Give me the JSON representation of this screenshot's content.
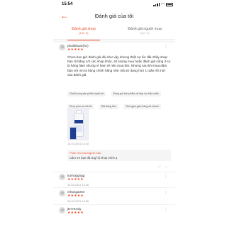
{
  "status_bar": {
    "time": "15:54"
  },
  "header": {
    "back_icon": "arrow-left-icon",
    "title": "Đánh giá của tôi"
  },
  "tabs": [
    {
      "label": "Đánh giá shop",
      "count": "(0,0 / 5)",
      "active": true
    },
    {
      "label": "Đánh giá người mua",
      "count": "(0,0 / 5)",
      "active": false
    }
  ],
  "reviews": [
    {
      "username": "phuletham(ho)",
      "stars": "★★★★★",
      "text": "Chưa bao giờ đánh giá dài như vậy nhưng thiệt sự lúc đầu thấy shop bán rẻ bằng 1/2 các shop khác, số lượng mua hoặc đánh giá cũng ít so là hàng fake nhưng vì ham rẻ nên mua thử. Nhưng sau khi mua đảm bảo với mn là hàng chính hãng nhé. Đã sử dụng hơn 1 tuần rồi mới vào đánh giá",
      "tags": [
        "Chất lượng sản phẩm tuyệt vời",
        "Đóng gói sản phẩm rất đẹp và chắc chắn",
        "Shop phục vụ rất tốt",
        "Rất đáng tiền",
        "Thời gian giao hàng rất nhanh"
      ],
      "date": "10-03-2021 14:18",
      "reply_header": "Phản Hồi của Người bán:",
      "reply_text": "Cảm ơn bạn đã ủng hộ shop mình ạ"
    },
    {
      "username": "tunhopgngg",
      "stars": "★★★★★",
      "date": "10-03-2021 10:26"
    },
    {
      "username": "mhang2204",
      "stars": "★★★★★",
      "date": "08-02-2021 15:55"
    },
    {
      "username": "jDYrKndy",
      "stars": "★★★★★"
    }
  ]
}
